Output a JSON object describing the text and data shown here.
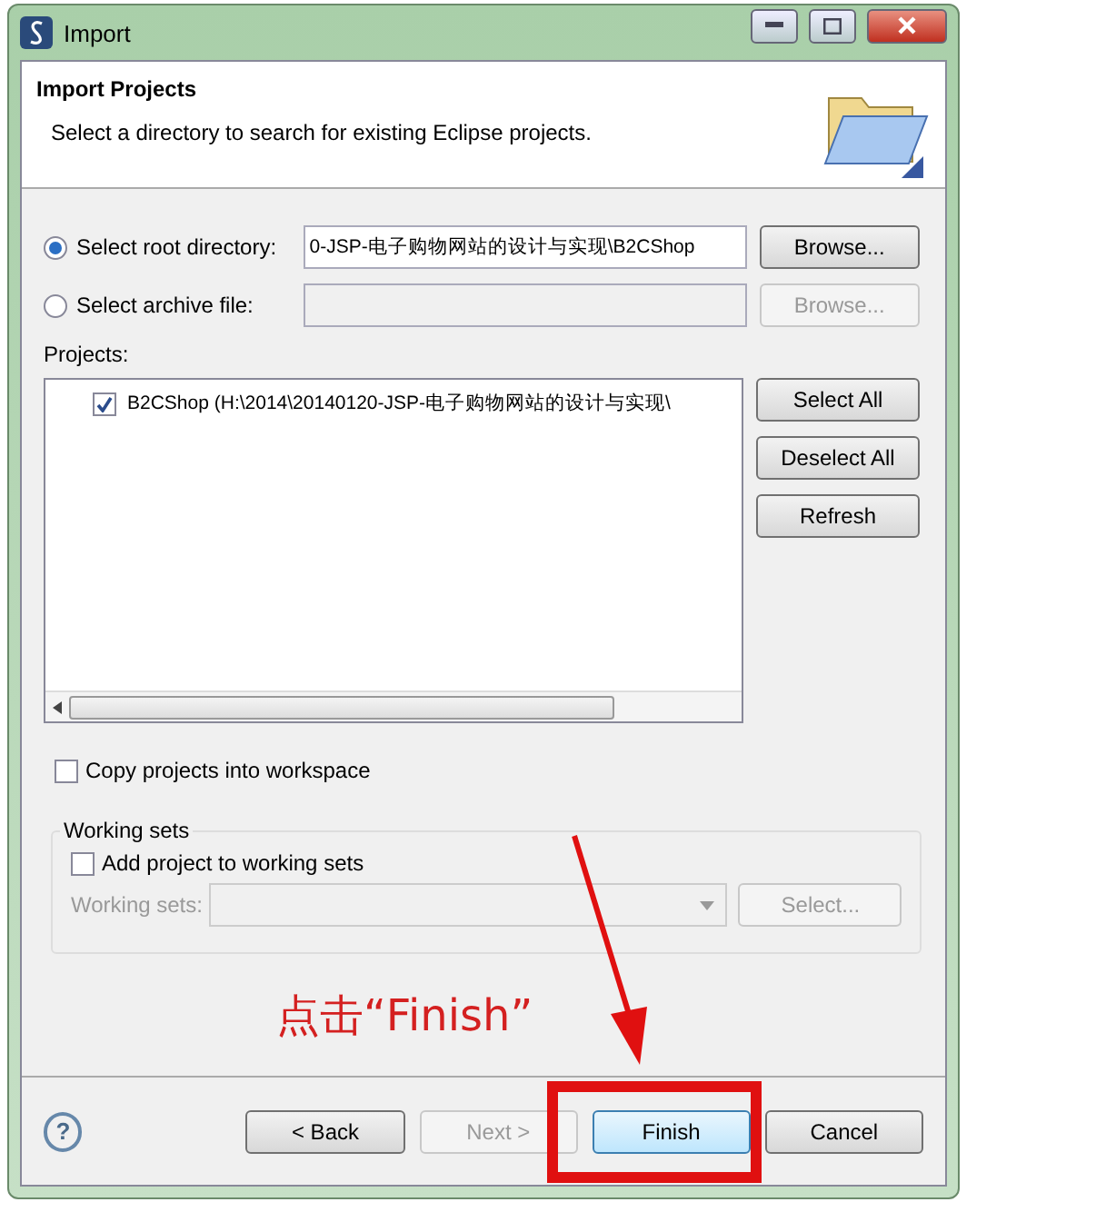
{
  "window": {
    "title": "Import"
  },
  "header": {
    "title": "Import Projects",
    "description": "Select a directory to search for existing Eclipse projects."
  },
  "sources": [
    {
      "label": "Select root directory:",
      "selected": true,
      "value": "0-JSP-电子购物网站的设计与实现\\B2CShop",
      "button": "Browse...",
      "disabled": false
    },
    {
      "label": "Select archive file:",
      "selected": false,
      "button": "Browse...",
      "disabled": true
    }
  ],
  "projects": {
    "label": "Projects:",
    "items": [
      {
        "name": "B2CShop (H:\\2014\\20140120-JSP-电子购物网站的设计与实现\\",
        "checked": true
      }
    ],
    "buttons": [
      "Select All",
      "Deselect All",
      "Refresh"
    ]
  },
  "copy_option": {
    "label": "Copy projects into workspace",
    "checked": false
  },
  "working_sets": {
    "title": "Working sets",
    "add_label": "Add project to working sets",
    "checked": false,
    "field_label": "Working sets:",
    "button": "Select..."
  },
  "annotation": "点击“Finish”",
  "help": "?",
  "footer": [
    {
      "label": "< Back",
      "disabled": false,
      "highlighted": false
    },
    {
      "label": "Next >",
      "disabled": true,
      "highlighted": false
    },
    {
      "label": "Finish",
      "disabled": false,
      "highlighted": true
    },
    {
      "label": "Cancel",
      "disabled": false,
      "highlighted": false
    }
  ]
}
